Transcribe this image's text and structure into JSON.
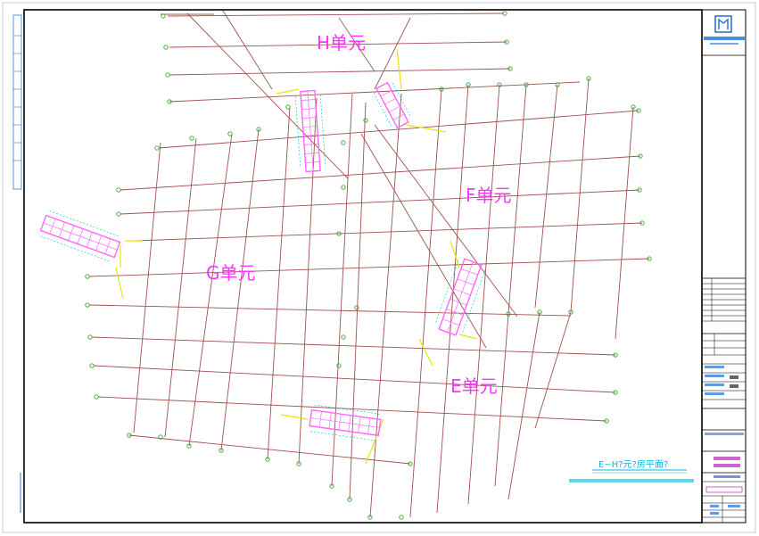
{
  "drawing": {
    "unit_labels": [
      {
        "text": "H单元"
      },
      {
        "text": "F单元"
      },
      {
        "text": "G单元"
      },
      {
        "text": "E单元"
      }
    ],
    "title_caption": "E~H?元?房平面?",
    "subtitle_caption": "",
    "colors": {
      "background": "#ffffff",
      "frame": "#000000",
      "axis_line": "#a05050",
      "building_outline": "#ff66ff",
      "annotation": "#00b8e6",
      "link_line": "#e6e600",
      "marker": "#33aa33",
      "unit_label": "#ff33ff",
      "title_block_blue": "#1c6fd4",
      "title_block_purple": "#c040c0"
    }
  }
}
